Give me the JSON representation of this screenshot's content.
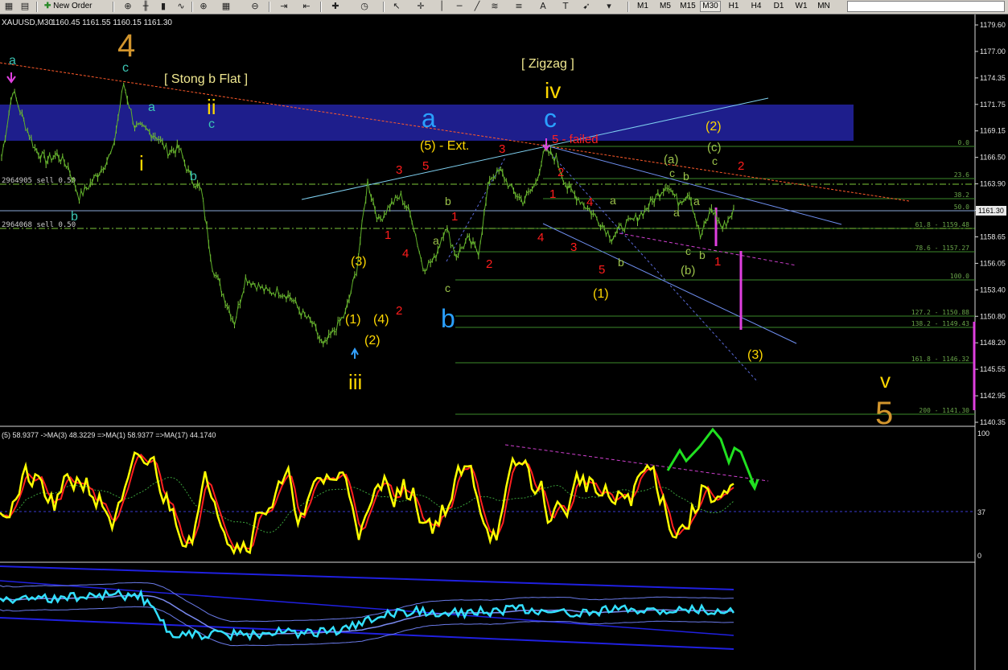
{
  "toolbar": {
    "new_order_label": "New Order",
    "timeframes": [
      "M1",
      "M5",
      "M15",
      "M30",
      "H1",
      "H4",
      "D1",
      "W1",
      "MN"
    ],
    "active_timeframe": "M30"
  },
  "header": {
    "symbol_tf": "XAUUSD,M30",
    "ohlc": "1160.45 1161.55 1160.15 1161.30"
  },
  "price_axis": {
    "ticks": [
      "1179.60",
      "1177.00",
      "1174.35",
      "1171.75",
      "1169.15",
      "1166.50",
      "1163.90",
      "1161.30",
      "1158.65",
      "1156.05",
      "1153.40",
      "1150.80",
      "1148.20",
      "1145.55",
      "1142.95",
      "1140.35"
    ],
    "current_price": "1161.30"
  },
  "orders": {
    "order1": "2964905 sell 0.50",
    "order2": "2964068 sell 0.50"
  },
  "fib_levels": [
    "0.0",
    "23.6",
    "38.2",
    "50.0",
    "61.8 - 1159.48",
    "78.6 - 1157.27",
    "100.0",
    "127.2 - 1150.88",
    "138.2 - 1149.43",
    "161.8 - 1146.32",
    "200 - 1141.30"
  ],
  "annotations": {
    "big4": "4",
    "big5": "5",
    "stong_b_flat": "[ Stong b Flat ]",
    "zigzag": "[ Zigzag ]",
    "iv": "iv",
    "ii": "ii",
    "iii": "iii",
    "i": "i",
    "v": "v",
    "a_big": "a",
    "c_big": "c",
    "b_big": "b",
    "ext": "(5) - Ext.",
    "failed": "5 - failed",
    "w3": "(3)",
    "w1": "(1)",
    "w2": "(2)",
    "w4": "(4)",
    "wb": "(b)",
    "wa": "(a)",
    "wc": "(c)",
    "w3r": "(3)",
    "w1r": "(1)",
    "w2r": "(2)",
    "a": "a",
    "b": "b",
    "c": "c",
    "n1": "1",
    "n2": "2",
    "n3": "3",
    "n4": "4",
    "n5": "5"
  },
  "osc1": {
    "header": "(5) 58.9377  ->MA(3) 48.3229  =>MA(1) 58.9377  =>MA(17) 44.1740",
    "ticks": [
      "100",
      "37",
      "0"
    ]
  },
  "colors": {
    "price_line": "#7ec83a",
    "blue_zone": "#1e1e8c",
    "osc_yellow": "#ffff00",
    "osc_red": "#ff2020",
    "cyan": "#33e0ff",
    "orange": "#d2952d",
    "wave_yellow": "#ffd800",
    "wave_red": "#ff1c1c",
    "wave_blue": "#2aa0ff",
    "wave_teal": "#3cc6b4",
    "wave_olive": "#9bc24a",
    "magenta": "#e040e0",
    "green_arrow": "#20e020"
  },
  "chart_data": {
    "type": "line",
    "title": "XAUUSD,M30",
    "ylim": [
      1140.35,
      1179.6
    ],
    "close_series": [
      1166.5,
      1173.2,
      1170.1,
      1167.4,
      1166.2,
      1166.8,
      1165.6,
      1162.6,
      1163.9,
      1165.4,
      1167.1,
      1173.8,
      1169.6,
      1169.2,
      1168.6,
      1167.1,
      1167.4,
      1164.6,
      1163.2,
      1155.8,
      1152.9,
      1150.2,
      1154.6,
      1153.9,
      1153.2,
      1153.3,
      1152.8,
      1151.2,
      1150.1,
      1147.8,
      1149.4,
      1151.1,
      1155.4,
      1164.1,
      1160.2,
      1161.8,
      1162.7,
      1160.5,
      1155.6,
      1156.4,
      1159.7,
      1156.8,
      1158.4,
      1157.2,
      1164.5,
      1165.1,
      1163.3,
      1162.2,
      1163.6,
      1167.2,
      1166.4,
      1163.5,
      1162.5,
      1161.3,
      1160.1,
      1158.6,
      1159.7,
      1160.3,
      1161.3,
      1162.6,
      1163.9,
      1162.1,
      1163.1,
      1158.6,
      1161.5,
      1159.5,
      1161.3
    ]
  }
}
